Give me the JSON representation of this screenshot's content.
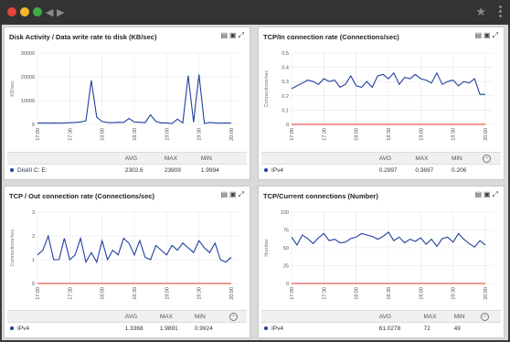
{
  "window": {
    "dots": [
      "#e8453c",
      "#f5b82e",
      "#3cb043"
    ],
    "nav_icons": [
      "back-arrow-icon",
      "forward-arrow-icon"
    ],
    "star_icon": "star-icon",
    "menu_icon": "kebab-menu-icon"
  },
  "panels": [
    {
      "title": "Disk Activity / Data write rate to disk (KB/sec)",
      "ylabel": "KB/sec",
      "yticks": [
        "30000",
        "20000",
        "10000",
        "0"
      ],
      "xticks": [
        "17:00",
        "17:30",
        "18:00",
        "18:30",
        "19:00",
        "19:30",
        "20:00",
        "20:30"
      ],
      "table_headers": [
        "AVG",
        "MAX",
        "MIN"
      ],
      "series_label": "Disk0 C: E:",
      "avg": "2302.6",
      "max": "23909",
      "min": "1.9994",
      "has_minus_button": false
    },
    {
      "title": "TCP/In connection rate (Connections/sec)",
      "ylabel": "Connections/sec",
      "yticks": [
        "0.5",
        "0.4",
        "0.3",
        "0.2",
        "0.1",
        "0"
      ],
      "xticks": [
        "17:00",
        "17:30",
        "18:00",
        "18:30",
        "19:00",
        "19:30",
        "20:00",
        "20:30"
      ],
      "table_headers": [
        "AVG",
        "MAX",
        "MIN"
      ],
      "series_label": "IPv4",
      "avg": "0.2997",
      "max": "0.3697",
      "min": "0.206",
      "has_minus_button": true
    },
    {
      "title": "TCP / Out connection rate (Connections/sec)",
      "ylabel": "Connections/sec",
      "yticks": [
        "3",
        "2",
        "1",
        "0"
      ],
      "xticks": [
        "17:00",
        "17:30",
        "18:00",
        "18:30",
        "19:00",
        "19:30",
        "20:00",
        "20:30"
      ],
      "table_headers": [
        "AVG",
        "MAX",
        "MIN"
      ],
      "series_label": "IPv4",
      "avg": "1.3368",
      "max": "1.9891",
      "min": "0.9924",
      "has_minus_button": true
    },
    {
      "title": "TCP/Current connections (Number)",
      "ylabel": "Number",
      "yticks": [
        "100",
        "75",
        "50",
        "25",
        "0"
      ],
      "xticks": [
        "17:00",
        "17:30",
        "18:00",
        "18:30",
        "19:00",
        "19:30",
        "20:00",
        "20:30"
      ],
      "table_headers": [
        "AVG",
        "MAX",
        "MIN"
      ],
      "series_label": "IPv4",
      "avg": "61.0278",
      "max": "72",
      "min": "49",
      "has_minus_button": true
    }
  ],
  "tool_icons": [
    "document-icon",
    "export-icon",
    "expand-icon"
  ],
  "colors": {
    "series": "#1f3f9f",
    "baseline": "#e0302a",
    "grid": "#e6e6e6"
  },
  "chart_data": [
    {
      "type": "line",
      "title": "Disk Activity / Data write rate to disk (KB/sec)",
      "ylabel": "KB/sec",
      "ylim": [
        0,
        30000
      ],
      "x": [
        "17:00",
        "17:05",
        "17:10",
        "17:15",
        "17:20",
        "17:25",
        "17:30",
        "17:35",
        "17:40",
        "17:45",
        "17:50",
        "17:55",
        "18:00",
        "18:05",
        "18:10",
        "18:15",
        "18:20",
        "18:25",
        "18:30",
        "18:35",
        "18:40",
        "18:45",
        "18:50",
        "18:55",
        "19:00",
        "19:05",
        "19:10",
        "19:15",
        "19:20",
        "19:25",
        "19:30",
        "19:35",
        "19:40",
        "19:45",
        "19:50",
        "19:55",
        "20:00"
      ],
      "series": [
        {
          "name": "Disk0 C: E:",
          "values": [
            500,
            600,
            500,
            600,
            500,
            600,
            700,
            800,
            1000,
            1500,
            18500,
            3000,
            1200,
            800,
            700,
            900,
            800,
            2500,
            1000,
            900,
            700,
            4000,
            1200,
            600,
            600,
            400,
            2200,
            600,
            20500,
            900,
            21000,
            400,
            800,
            600,
            500,
            600,
            500
          ]
        }
      ]
    },
    {
      "type": "line",
      "title": "TCP/In connection rate (Connections/sec)",
      "ylabel": "Connections/sec",
      "ylim": [
        0,
        0.5
      ],
      "x": [
        "17:00",
        "17:05",
        "17:10",
        "17:15",
        "17:20",
        "17:25",
        "17:30",
        "17:35",
        "17:40",
        "17:45",
        "17:50",
        "17:55",
        "18:00",
        "18:05",
        "18:10",
        "18:15",
        "18:20",
        "18:25",
        "18:30",
        "18:35",
        "18:40",
        "18:45",
        "18:50",
        "18:55",
        "19:00",
        "19:05",
        "19:10",
        "19:15",
        "19:20",
        "19:25",
        "19:30",
        "19:35",
        "19:40",
        "19:45",
        "19:50",
        "19:55",
        "20:00"
      ],
      "series": [
        {
          "name": "IPv4",
          "values": [
            0.25,
            0.27,
            0.29,
            0.31,
            0.3,
            0.28,
            0.32,
            0.3,
            0.31,
            0.26,
            0.28,
            0.34,
            0.27,
            0.26,
            0.3,
            0.26,
            0.34,
            0.35,
            0.32,
            0.36,
            0.28,
            0.33,
            0.32,
            0.35,
            0.32,
            0.31,
            0.29,
            0.36,
            0.28,
            0.3,
            0.31,
            0.27,
            0.3,
            0.29,
            0.32,
            0.21,
            0.21
          ]
        },
        {
          "name": "",
          "values": [
            0,
            0,
            0,
            0,
            0,
            0,
            0,
            0,
            0,
            0,
            0,
            0,
            0,
            0,
            0,
            0,
            0,
            0,
            0,
            0,
            0,
            0,
            0,
            0,
            0,
            0,
            0,
            0,
            0,
            0,
            0,
            0,
            0,
            0,
            0,
            0,
            0
          ]
        }
      ]
    },
    {
      "type": "line",
      "title": "TCP / Out connection rate (Connections/sec)",
      "ylabel": "Connections/sec",
      "ylim": [
        0,
        3
      ],
      "x": [
        "17:00",
        "17:05",
        "17:10",
        "17:15",
        "17:20",
        "17:25",
        "17:30",
        "17:35",
        "17:40",
        "17:45",
        "17:50",
        "17:55",
        "18:00",
        "18:05",
        "18:10",
        "18:15",
        "18:20",
        "18:25",
        "18:30",
        "18:35",
        "18:40",
        "18:45",
        "18:50",
        "18:55",
        "19:00",
        "19:05",
        "19:10",
        "19:15",
        "19:20",
        "19:25",
        "19:30",
        "19:35",
        "19:40",
        "19:45",
        "19:50",
        "19:55",
        "20:00"
      ],
      "series": [
        {
          "name": "IPv4",
          "values": [
            1.2,
            1.4,
            2.0,
            1.0,
            1.0,
            1.9,
            1.0,
            1.2,
            1.9,
            0.9,
            1.3,
            0.9,
            1.8,
            1.0,
            1.4,
            1.2,
            1.9,
            1.7,
            1.2,
            1.8,
            1.1,
            1.0,
            1.6,
            1.4,
            1.2,
            1.6,
            1.4,
            1.7,
            1.5,
            1.3,
            1.8,
            1.5,
            1.3,
            1.7,
            1.0,
            0.9,
            1.1
          ]
        },
        {
          "name": "",
          "values": [
            0,
            0,
            0,
            0,
            0,
            0,
            0,
            0,
            0,
            0,
            0,
            0,
            0,
            0,
            0,
            0,
            0,
            0,
            0,
            0,
            0,
            0,
            0,
            0,
            0,
            0,
            0,
            0,
            0,
            0,
            0,
            0,
            0,
            0,
            0,
            0,
            0
          ]
        }
      ]
    },
    {
      "type": "line",
      "title": "TCP/Current connections (Number)",
      "ylabel": "Number",
      "ylim": [
        0,
        100
      ],
      "x": [
        "17:00",
        "17:05",
        "17:10",
        "17:15",
        "17:20",
        "17:25",
        "17:30",
        "17:35",
        "17:40",
        "17:45",
        "17:50",
        "17:55",
        "18:00",
        "18:05",
        "18:10",
        "18:15",
        "18:20",
        "18:25",
        "18:30",
        "18:35",
        "18:40",
        "18:45",
        "18:50",
        "18:55",
        "19:00",
        "19:05",
        "19:10",
        "19:15",
        "19:20",
        "19:25",
        "19:30",
        "19:35",
        "19:40",
        "19:45",
        "19:50",
        "19:55",
        "20:00"
      ],
      "series": [
        {
          "name": "IPv4",
          "values": [
            65,
            54,
            68,
            63,
            56,
            64,
            70,
            60,
            62,
            57,
            58,
            63,
            65,
            70,
            68,
            66,
            62,
            66,
            72,
            60,
            65,
            57,
            62,
            59,
            64,
            55,
            62,
            52,
            63,
            65,
            58,
            70,
            62,
            56,
            51,
            60,
            54
          ]
        },
        {
          "name": "",
          "values": [
            0,
            0,
            0,
            0,
            0,
            0,
            0,
            0,
            0,
            0,
            0,
            0,
            0,
            0,
            0,
            0,
            0,
            0,
            0,
            0,
            0,
            0,
            0,
            0,
            0,
            0,
            0,
            0,
            0,
            0,
            0,
            0,
            0,
            0,
            0,
            0,
            0
          ]
        }
      ]
    }
  ]
}
